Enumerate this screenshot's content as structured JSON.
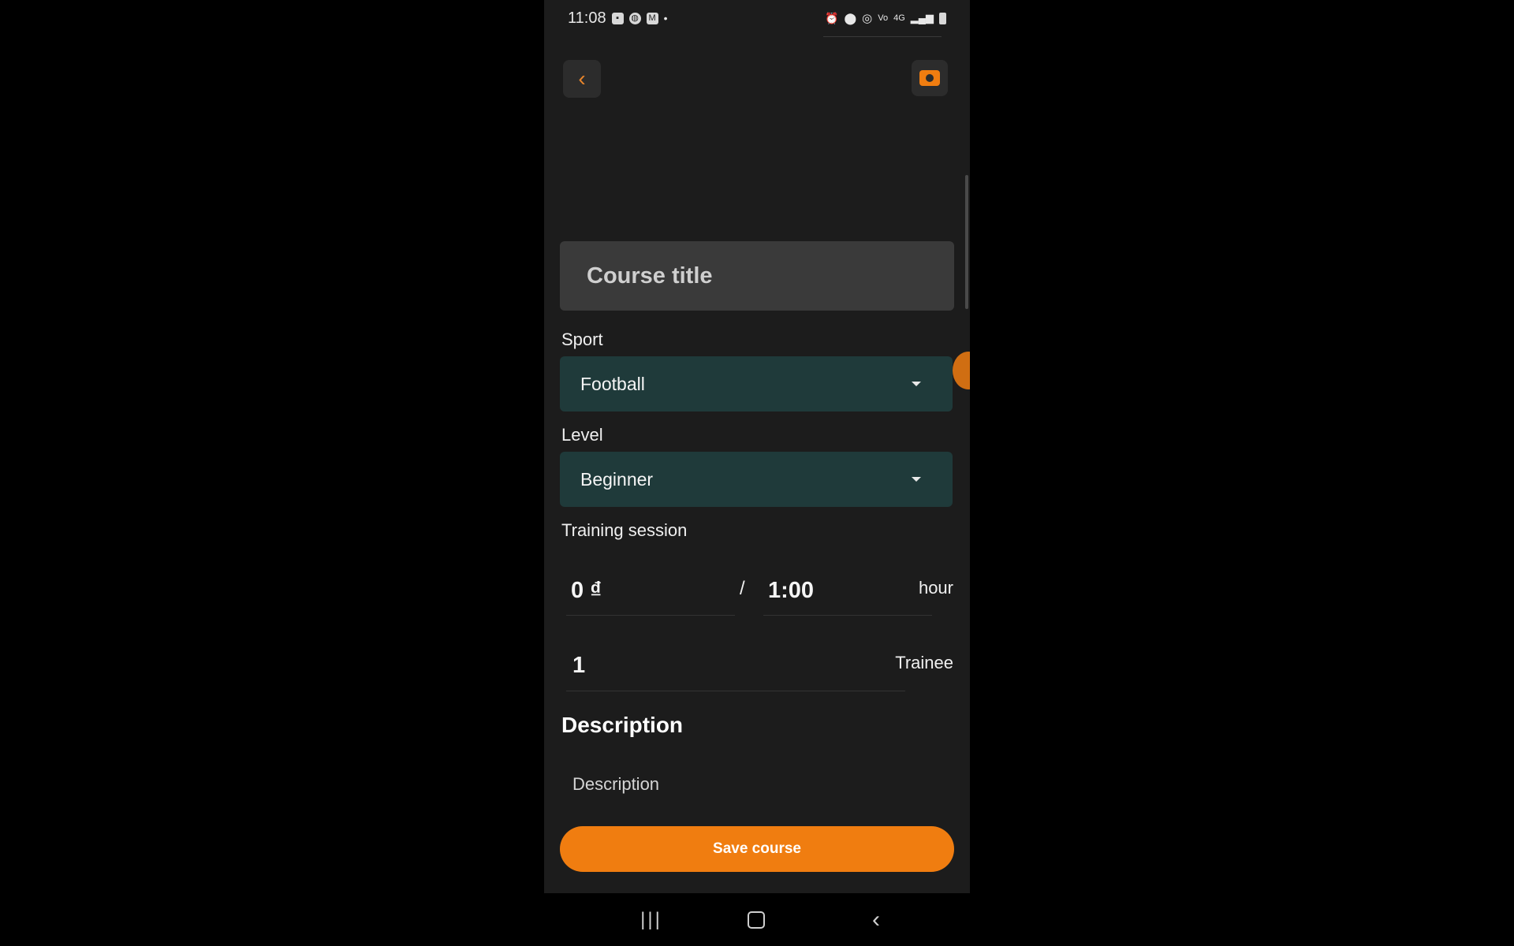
{
  "status_bar": {
    "time": "11:08",
    "left_icons": [
      "notification-icon",
      "chrome-icon",
      "gmail-icon"
    ],
    "right_icons": [
      "alarm-icon",
      "location-icon",
      "hotspot-icon",
      "volte-icon",
      "4g-icon",
      "signal-icon",
      "battery-icon"
    ],
    "network_text": "4G"
  },
  "header": {
    "back_icon": "chevron-left-icon",
    "camera_icon": "camera-icon"
  },
  "form": {
    "title_placeholder": "Course title",
    "sport_label": "Sport",
    "sport_value": "Football",
    "level_label": "Level",
    "level_value": "Beginner",
    "training_label": "Training session",
    "price_value": "0 ₫",
    "separator": "/",
    "duration_value": "1:00",
    "duration_unit": "hour",
    "trainee_value": "1",
    "trainee_unit": "Trainee",
    "description_heading": "Description",
    "description_placeholder": "Description",
    "save_label": "Save course"
  },
  "colors": {
    "accent": "#f07d10",
    "select_bg": "#1f3a3a",
    "screen_bg": "#1c1c1c"
  },
  "nav": {
    "recents_icon": "recents-icon",
    "home_icon": "home-icon",
    "back_icon": "back-icon"
  }
}
